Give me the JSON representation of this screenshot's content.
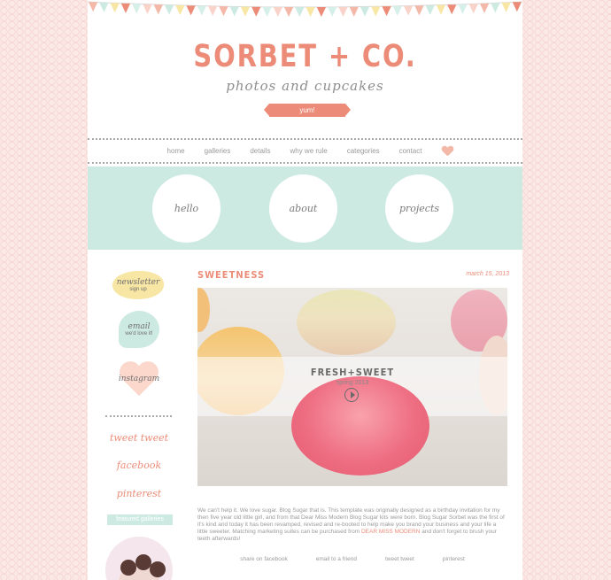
{
  "brand": {
    "name": "SORBET + CO.",
    "tagline": "photos and cupcakes",
    "ribbon": "yum!"
  },
  "nav": {
    "items": [
      "home",
      "galleries",
      "details",
      "why we rule",
      "categories",
      "contact"
    ]
  },
  "circles": [
    "hello",
    "about",
    "projects"
  ],
  "sidebar": {
    "newsletter": {
      "label": "newsletter",
      "sub": "sign up"
    },
    "email": {
      "label": "email",
      "sub": "we'd love it!"
    },
    "instagram": "instagram",
    "links": [
      "tweet tweet",
      "facebook",
      "pinterest"
    ],
    "featured": "featured galleries"
  },
  "post": {
    "title": "SWEETNESS",
    "date": "march 15, 2013",
    "hero": {
      "title": "FRESH+SWEET",
      "subtitle": "spring 2013"
    },
    "body_before": "We can't help it. We love sugar. Blog Sugar that is. This template was originally designed as a birthday invitation for my then five year old little girl, and from that Dear Miss Modern Blog Sugar kits were born. Blog Sugar Sorbet was the first of it's kind and today it has been revamped, revised and re-booted to help make you brand your business and your life a little sweeter. Matching marketing suites can be purchased from ",
    "body_link": "DEAR MISS MODERN",
    "body_after": " and don't forget to brush your teeth afterwards!",
    "shares": [
      "share on facebook",
      "email to a friend",
      "tweet tweet",
      "pinterest"
    ]
  },
  "colors": {
    "coral": "#ec8c78",
    "mint": "#cdeae2",
    "butter": "#f7e6a4",
    "blush": "#fbd7cc"
  }
}
